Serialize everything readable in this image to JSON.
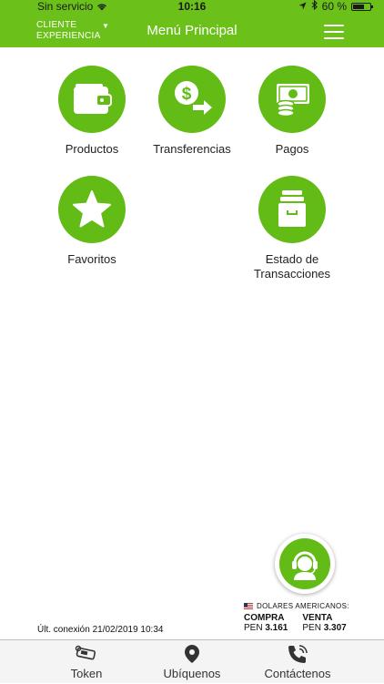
{
  "status": {
    "carrier": "Sin servicio",
    "time": "10:16",
    "battery": "60 %"
  },
  "header": {
    "client_line1": "CLIENTE",
    "client_line2": "EXPERIENCIA",
    "title": "Menú Principal",
    "menu_icon": "hamburger-icon"
  },
  "tiles": [
    {
      "label": "Productos",
      "icon": "wallet-icon"
    },
    {
      "label": "Transferencias",
      "icon": "money-transfer-icon"
    },
    {
      "label": "Pagos",
      "icon": "bills-coins-icon"
    },
    {
      "label": "Favoritos",
      "icon": "star-icon"
    },
    {
      "label_line1": "Estado de",
      "label_line2": "Transacciones",
      "icon": "archive-box-icon"
    }
  ],
  "footer": {
    "last_connection": "Últ. conexión 21/02/2019 10:34",
    "fx": {
      "title": "DOLARES AMERICANOS:",
      "buy_label": "COMPRA",
      "buy_currency": "PEN",
      "buy_value": "3.161",
      "sell_label": "VENTA",
      "sell_currency": "PEN",
      "sell_value": "3.307"
    }
  },
  "tabbar": [
    {
      "label": "Token",
      "icon": "token-key-icon"
    },
    {
      "label": "Ubíquenos",
      "icon": "map-pin-icon"
    },
    {
      "label": "Contáctenos",
      "icon": "phone-icon"
    }
  ],
  "colors": {
    "brand_green": "#6cc01a",
    "tile_green": "#63bb16"
  }
}
